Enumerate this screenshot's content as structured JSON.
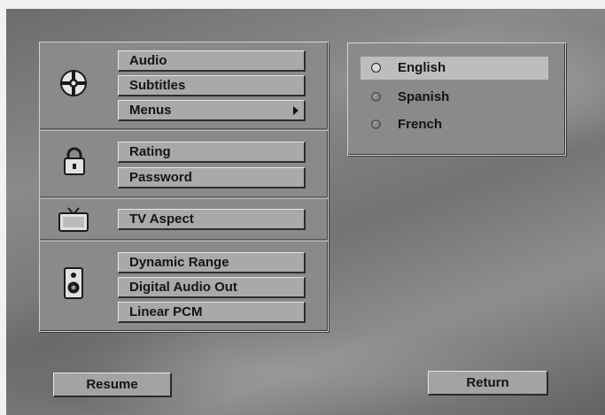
{
  "menu": {
    "groups": [
      {
        "icon": "disc-icon",
        "items": [
          {
            "label": "Audio"
          },
          {
            "label": "Subtitles"
          },
          {
            "label": "Menus",
            "has_submenu": true
          }
        ]
      },
      {
        "icon": "padlock-icon",
        "items": [
          {
            "label": "Rating"
          },
          {
            "label": "Password"
          }
        ]
      },
      {
        "icon": "tv-icon",
        "items": [
          {
            "label": "TV Aspect"
          }
        ]
      },
      {
        "icon": "speaker-icon",
        "items": [
          {
            "label": "Dynamic Range"
          },
          {
            "label": "Digital Audio Out"
          },
          {
            "label": "Linear PCM"
          }
        ]
      }
    ]
  },
  "submenu": {
    "options": [
      {
        "label": "English",
        "selected": true
      },
      {
        "label": "Spanish",
        "selected": false
      },
      {
        "label": "French",
        "selected": false
      }
    ]
  },
  "footer": {
    "resume_label": "Resume",
    "return_label": "Return"
  }
}
